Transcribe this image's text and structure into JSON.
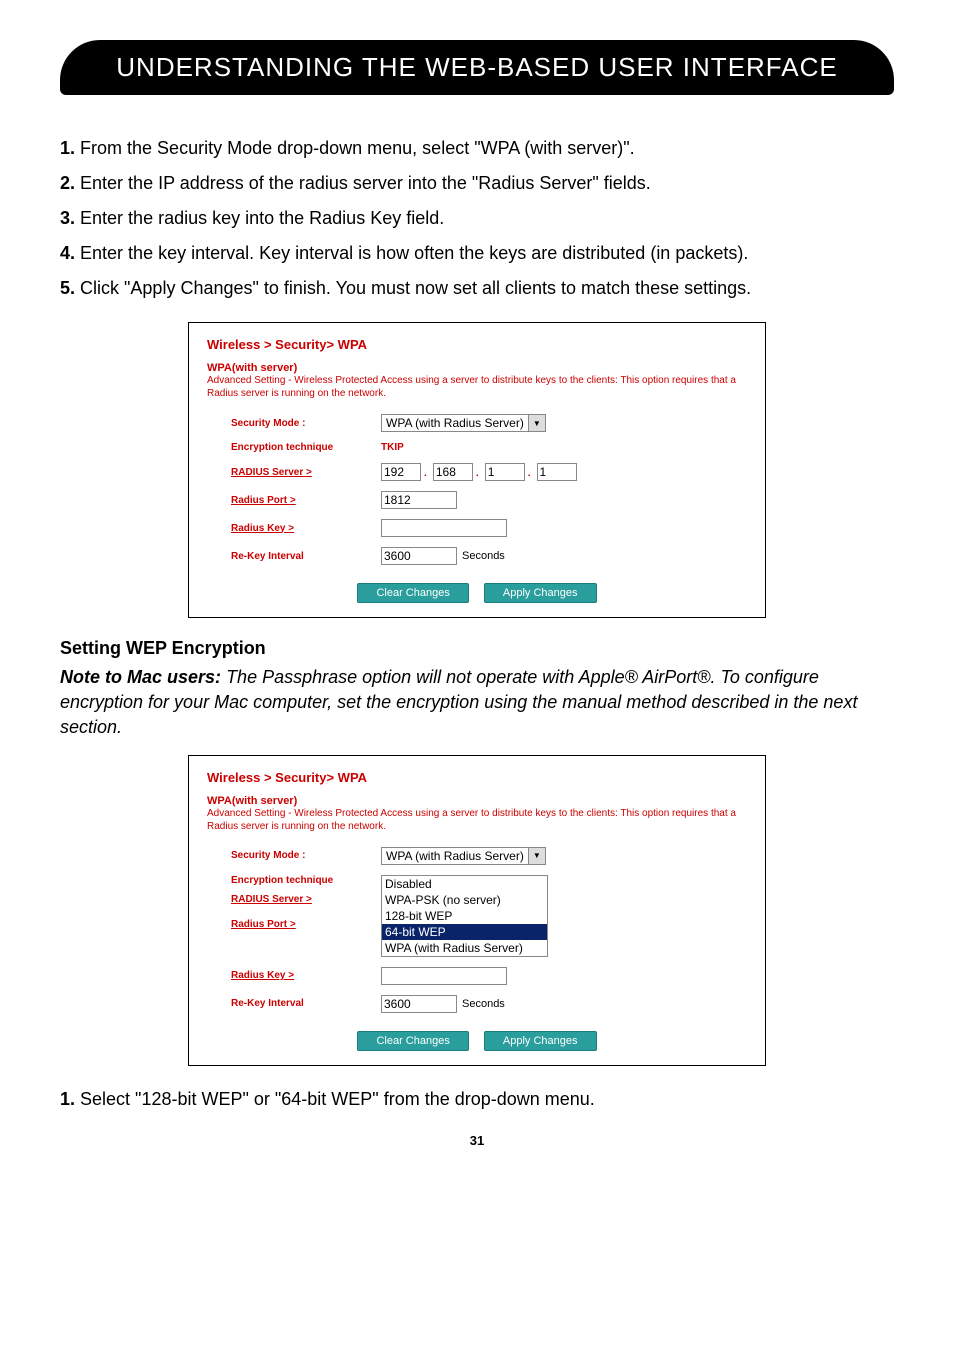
{
  "header": {
    "title": "UNDERSTANDING THE WEB-BASED USER INTERFACE"
  },
  "instructions_top": [
    {
      "num": "1.",
      "text": "From the Security Mode drop-down menu, select \"WPA (with server)\"."
    },
    {
      "num": "2.",
      "text": "Enter the IP address of the radius server into the \"Radius Server\" fields."
    },
    {
      "num": "3.",
      "text": "Enter the radius key into the Radius Key field."
    },
    {
      "num": "4.",
      "text": "Enter the key interval. Key interval is how often the keys are distributed (in packets)."
    },
    {
      "num": "5.",
      "text": "Click \"Apply Changes\" to finish. You must now set all clients to match these settings."
    }
  ],
  "screenshot1": {
    "breadcrumb": "Wireless > Security> WPA",
    "subhead": "WPA(with server)",
    "description": "Advanced Setting - Wireless Protected Access using a server to distribute keys to the clients: This option requires that a Radius server is running on the network.",
    "labels": {
      "security_mode": "Security Mode :",
      "encryption": "Encryption technique",
      "radius_server": "RADIUS Server >",
      "radius_port": "Radius Port >",
      "radius_key": "Radius Key >",
      "rekey": "Re-Key Interval"
    },
    "values": {
      "security_mode_option": "WPA (with Radius Server)",
      "encryption_value": "TKIP",
      "ip": [
        "192",
        "168",
        "1",
        "1"
      ],
      "port": "1812",
      "key": "",
      "rekey": "3600",
      "seconds": "Seconds"
    },
    "buttons": {
      "clear": "Clear Changes",
      "apply": "Apply Changes"
    }
  },
  "section_title": "Setting WEP Encryption",
  "note": {
    "lead": "Note to Mac users:",
    "body": "The Passphrase option will not operate with Apple® AirPort®. To configure encryption for your Mac computer, set the encryption using the manual method described in the next section."
  },
  "screenshot2": {
    "breadcrumb": "Wireless > Security> WPA",
    "subhead": "WPA(with server)",
    "description": "Advanced Setting - Wireless Protected Access using a server to distribute keys to the clients: This option requires that a Radius server is running on the network.",
    "labels": {
      "security_mode": "Security Mode :",
      "encryption": "Encryption technique",
      "radius_server": "RADIUS Server >",
      "radius_port": "Radius Port >",
      "radius_key": "Radius Key >",
      "rekey": "Re-Key Interval"
    },
    "values": {
      "security_mode_option": "WPA (with Radius Server)",
      "dropdown_options": [
        "Disabled",
        "WPA-PSK (no server)",
        "128-bit WEP",
        "64-bit WEP",
        "WPA (with Radius Server)"
      ],
      "dropdown_selected_index": 3,
      "key": "",
      "rekey": "3600",
      "seconds": "Seconds"
    },
    "buttons": {
      "clear": "Clear Changes",
      "apply": "Apply Changes"
    }
  },
  "instructions_bottom": [
    {
      "num": "1.",
      "text": "Select \"128-bit WEP\" or \"64-bit WEP\" from the drop-down menu."
    }
  ],
  "page_number": "31"
}
